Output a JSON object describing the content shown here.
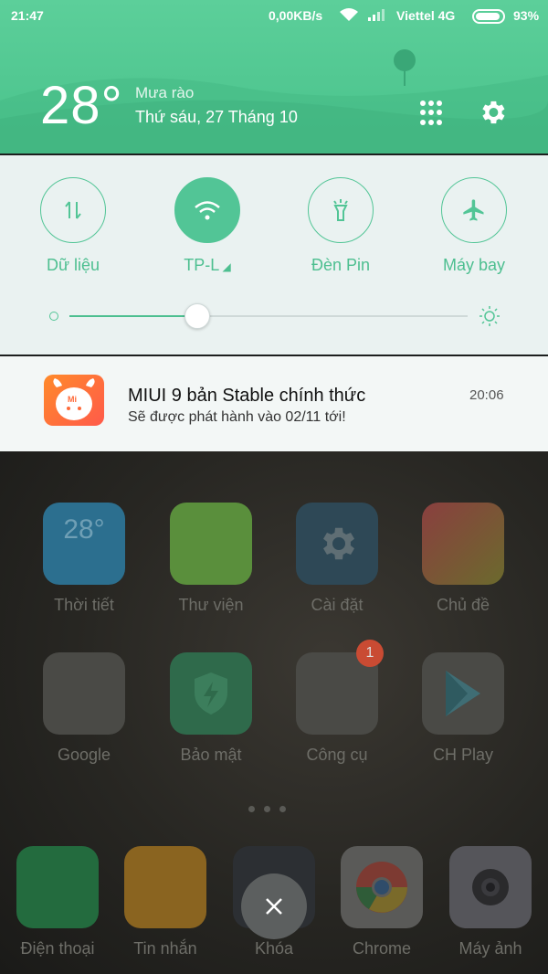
{
  "status_bar": {
    "time": "21:47",
    "network_speed": "0,00KB/s",
    "carrier": "Viettel 4G",
    "battery": "93%",
    "battery_level": 0.93
  },
  "weather": {
    "temperature": "28°",
    "condition": "Mưa rào",
    "date": "Thứ sáu, 27 Tháng 10"
  },
  "quick_settings": {
    "toggles": [
      {
        "label": "Dữ liệu",
        "icon": "data-arrows-icon",
        "on": false
      },
      {
        "label": "TP-L",
        "icon": "wifi-icon",
        "on": true
      },
      {
        "label": "Đèn Pin",
        "icon": "flashlight-icon",
        "on": false
      },
      {
        "label": "Máy bay",
        "icon": "airplane-icon",
        "on": false
      }
    ],
    "brightness_level": 0.32
  },
  "notification": {
    "app": "Mi",
    "title": "MIUI 9 bản Stable chính thức",
    "body": "Sẽ được phát hành vào 02/11 tới!",
    "time": "20:06"
  },
  "home_apps": [
    {
      "label": "Thời tiết",
      "icon_text": "28°",
      "color": "#2c6f8f"
    },
    {
      "label": "Thư viện",
      "icon_text": "",
      "color": "#5a8f3c"
    },
    {
      "label": "Cài đặt",
      "icon_text": "",
      "color": "#2e4856"
    },
    {
      "label": "Chủ đề",
      "icon_text": "",
      "color": "#8a3f3f"
    },
    {
      "label": "Google",
      "icon_text": "",
      "color": "#4a4a46"
    },
    {
      "label": "Bảo mật",
      "icon_text": "",
      "color": "#2f6a4b"
    },
    {
      "label": "Công cụ",
      "icon_text": "",
      "color": "#4a4a46"
    },
    {
      "label": "CH Play",
      "icon_text": "",
      "color": "#4a4a46"
    }
  ],
  "dock_apps": [
    {
      "label": "Điện thoại",
      "color": "#236b3e"
    },
    {
      "label": "Tin nhắn",
      "color": "#8a6420"
    },
    {
      "label": "Khóa",
      "color": "#2c2f33"
    },
    {
      "label": "Chrome",
      "color": "#5a5a58"
    },
    {
      "label": "Máy ảnh",
      "color": "#55555a"
    }
  ],
  "tools_badge": "1",
  "colors": {
    "accent": "#52c596"
  }
}
